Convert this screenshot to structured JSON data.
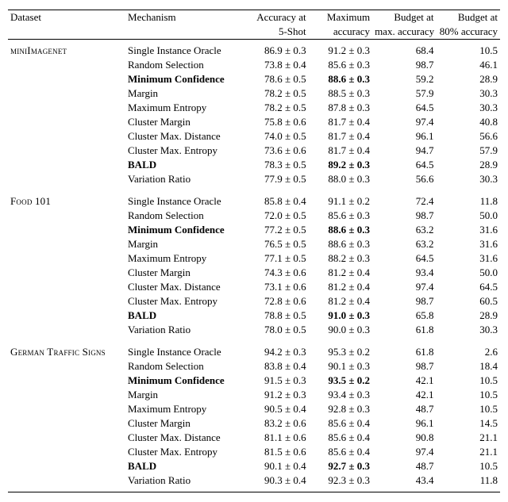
{
  "header": {
    "col_dataset": "Dataset",
    "col_mechanism": "Mechanism",
    "col_acc5_line1": "Accuracy at",
    "col_acc5_line2": "5-Shot",
    "col_maxacc_line1": "Maximum",
    "col_maxacc_line2": "accuracy",
    "col_budmax_line1": "Budget at",
    "col_budmax_line2": "max. accuracy",
    "col_bud80_line1": "Budget at",
    "col_bud80_line2": "80% accuracy"
  },
  "chart_data": {
    "type": "table",
    "columns": [
      "Dataset",
      "Mechanism",
      "Accuracy at 5-Shot",
      "Maximum accuracy",
      "Budget at max. accuracy",
      "Budget at 80% accuracy"
    ]
  },
  "groups": [
    {
      "dataset_display": "miniImagenet",
      "rows": [
        {
          "mech": "Single Instance Oracle",
          "mech_bold": false,
          "acc5": "86.9 ± 0.3",
          "maxacc": "91.2 ± 0.3",
          "max_bold": false,
          "budmax": "68.4",
          "bud80": "10.5"
        },
        {
          "mech": "Random Selection",
          "mech_bold": false,
          "acc5": "73.8 ± 0.4",
          "maxacc": "85.6 ± 0.3",
          "max_bold": false,
          "budmax": "98.7",
          "bud80": "46.1"
        },
        {
          "mech": "Minimum Confidence",
          "mech_bold": true,
          "acc5": "78.6 ± 0.5",
          "maxacc": "88.6 ± 0.3",
          "max_bold": true,
          "budmax": "59.2",
          "bud80": "28.9"
        },
        {
          "mech": "Margin",
          "mech_bold": false,
          "acc5": "78.2 ± 0.5",
          "maxacc": "88.5 ± 0.3",
          "max_bold": false,
          "budmax": "57.9",
          "bud80": "30.3"
        },
        {
          "mech": "Maximum Entropy",
          "mech_bold": false,
          "acc5": "78.2 ± 0.5",
          "maxacc": "87.8 ± 0.3",
          "max_bold": false,
          "budmax": "64.5",
          "bud80": "30.3"
        },
        {
          "mech": "Cluster Margin",
          "mech_bold": false,
          "acc5": "75.8 ± 0.6",
          "maxacc": "81.7 ± 0.4",
          "max_bold": false,
          "budmax": "97.4",
          "bud80": "40.8"
        },
        {
          "mech": "Cluster Max. Distance",
          "mech_bold": false,
          "acc5": "74.0 ± 0.5",
          "maxacc": "81.7 ± 0.4",
          "max_bold": false,
          "budmax": "96.1",
          "bud80": "56.6"
        },
        {
          "mech": "Cluster Max. Entropy",
          "mech_bold": false,
          "acc5": "73.6 ± 0.6",
          "maxacc": "81.7 ± 0.4",
          "max_bold": false,
          "budmax": "94.7",
          "bud80": "57.9"
        },
        {
          "mech": "BALD",
          "mech_bold": true,
          "acc5": "78.3 ± 0.5",
          "maxacc": "89.2 ± 0.3",
          "max_bold": true,
          "budmax": "64.5",
          "bud80": "28.9"
        },
        {
          "mech": "Variation Ratio",
          "mech_bold": false,
          "acc5": "77.9 ± 0.5",
          "maxacc": "88.0 ± 0.3",
          "max_bold": false,
          "budmax": "56.6",
          "bud80": "30.3"
        }
      ]
    },
    {
      "dataset_display": "Food 101",
      "rows": [
        {
          "mech": "Single Instance Oracle",
          "mech_bold": false,
          "acc5": "85.8 ± 0.4",
          "maxacc": "91.1 ± 0.2",
          "max_bold": false,
          "budmax": "72.4",
          "bud80": "11.8"
        },
        {
          "mech": "Random Selection",
          "mech_bold": false,
          "acc5": "72.0 ± 0.5",
          "maxacc": "85.6 ± 0.3",
          "max_bold": false,
          "budmax": "98.7",
          "bud80": "50.0"
        },
        {
          "mech": "Minimum Confidence",
          "mech_bold": true,
          "acc5": "77.2 ± 0.5",
          "maxacc": "88.6 ± 0.3",
          "max_bold": true,
          "budmax": "63.2",
          "bud80": "31.6"
        },
        {
          "mech": "Margin",
          "mech_bold": false,
          "acc5": "76.5 ± 0.5",
          "maxacc": "88.6 ± 0.3",
          "max_bold": false,
          "budmax": "63.2",
          "bud80": "31.6"
        },
        {
          "mech": "Maximum Entropy",
          "mech_bold": false,
          "acc5": "77.1 ± 0.5",
          "maxacc": "88.2 ± 0.3",
          "max_bold": false,
          "budmax": "64.5",
          "bud80": "31.6"
        },
        {
          "mech": "Cluster Margin",
          "mech_bold": false,
          "acc5": "74.3 ± 0.6",
          "maxacc": "81.2 ± 0.4",
          "max_bold": false,
          "budmax": "93.4",
          "bud80": "50.0"
        },
        {
          "mech": "Cluster Max. Distance",
          "mech_bold": false,
          "acc5": "73.1 ± 0.6",
          "maxacc": "81.2 ± 0.4",
          "max_bold": false,
          "budmax": "97.4",
          "bud80": "64.5"
        },
        {
          "mech": "Cluster Max. Entropy",
          "mech_bold": false,
          "acc5": "72.8 ± 0.6",
          "maxacc": "81.2 ± 0.4",
          "max_bold": false,
          "budmax": "98.7",
          "bud80": "60.5"
        },
        {
          "mech": "BALD",
          "mech_bold": true,
          "acc5": "78.8 ± 0.5",
          "maxacc": "91.0 ± 0.3",
          "max_bold": true,
          "budmax": "65.8",
          "bud80": "28.9"
        },
        {
          "mech": "Variation Ratio",
          "mech_bold": false,
          "acc5": "78.0 ± 0.5",
          "maxacc": "90.0 ± 0.3",
          "max_bold": false,
          "budmax": "61.8",
          "bud80": "30.3"
        }
      ]
    },
    {
      "dataset_display": "German Traffic Signs",
      "rows": [
        {
          "mech": "Single Instance Oracle",
          "mech_bold": false,
          "acc5": "94.2 ± 0.3",
          "maxacc": "95.3 ± 0.2",
          "max_bold": false,
          "budmax": "61.8",
          "bud80": "2.6"
        },
        {
          "mech": "Random Selection",
          "mech_bold": false,
          "acc5": "83.8 ± 0.4",
          "maxacc": "90.1 ± 0.3",
          "max_bold": false,
          "budmax": "98.7",
          "bud80": "18.4"
        },
        {
          "mech": "Minimum Confidence",
          "mech_bold": true,
          "acc5": "91.5 ± 0.3",
          "maxacc": "93.5 ± 0.2",
          "max_bold": true,
          "budmax": "42.1",
          "bud80": "10.5"
        },
        {
          "mech": "Margin",
          "mech_bold": false,
          "acc5": "91.2 ± 0.3",
          "maxacc": "93.4 ± 0.3",
          "max_bold": false,
          "budmax": "42.1",
          "bud80": "10.5"
        },
        {
          "mech": "Maximum Entropy",
          "mech_bold": false,
          "acc5": "90.5 ± 0.4",
          "maxacc": "92.8 ± 0.3",
          "max_bold": false,
          "budmax": "48.7",
          "bud80": "10.5"
        },
        {
          "mech": "Cluster Margin",
          "mech_bold": false,
          "acc5": "83.2 ± 0.6",
          "maxacc": "85.6 ± 0.4",
          "max_bold": false,
          "budmax": "96.1",
          "bud80": "14.5"
        },
        {
          "mech": "Cluster Max. Distance",
          "mech_bold": false,
          "acc5": "81.1 ± 0.6",
          "maxacc": "85.6 ± 0.4",
          "max_bold": false,
          "budmax": "90.8",
          "bud80": "21.1"
        },
        {
          "mech": "Cluster Max. Entropy",
          "mech_bold": false,
          "acc5": "81.5 ± 0.6",
          "maxacc": "85.6 ± 0.4",
          "max_bold": false,
          "budmax": "97.4",
          "bud80": "21.1"
        },
        {
          "mech": "BALD",
          "mech_bold": true,
          "acc5": "90.1 ± 0.4",
          "maxacc": "92.7 ± 0.3",
          "max_bold": true,
          "budmax": "48.7",
          "bud80": "10.5"
        },
        {
          "mech": "Variation Ratio",
          "mech_bold": false,
          "acc5": "90.3 ± 0.4",
          "maxacc": "92.3 ± 0.3",
          "max_bold": false,
          "budmax": "43.4",
          "bud80": "11.8"
        }
      ]
    }
  ]
}
